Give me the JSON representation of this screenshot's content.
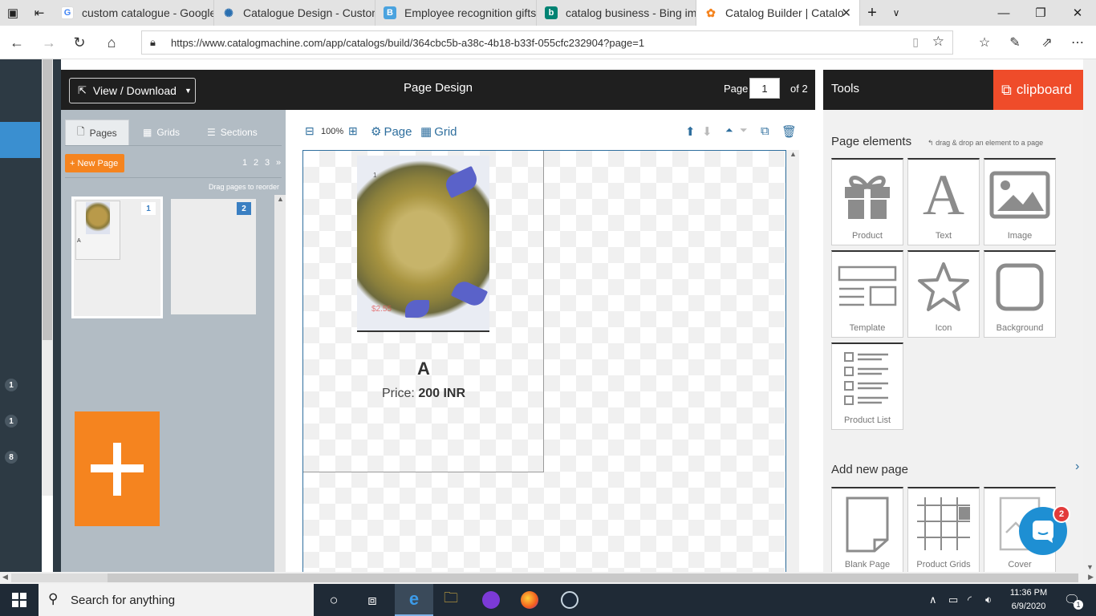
{
  "browser": {
    "tabs": [
      {
        "title": "custom catalogue - Google",
        "icon": "google-icon"
      },
      {
        "title": "Catalogue Design - Custom",
        "icon": "gear-icon"
      },
      {
        "title": "Employee recognition gifts",
        "icon": "b-icon"
      },
      {
        "title": "catalog business - Bing ima",
        "icon": "bing-icon"
      },
      {
        "title": "Catalog Builder | Catalo",
        "icon": "catalog-icon"
      }
    ],
    "url": "https://www.catalogmachine.com/app/catalogs/build/364cbc5b-a38c-4b18-b33f-055cfc232904?page=1"
  },
  "rail": {
    "badges": [
      "1",
      "1",
      "8"
    ]
  },
  "designer": {
    "view_download": "View / Download",
    "title": "Page Design",
    "page_label": "Page",
    "page_value": "1",
    "of_label": "of 2"
  },
  "pages_panel": {
    "tabs": [
      "Pages",
      "Grids",
      "Sections"
    ],
    "new_page": "+ New Page",
    "page_numbers": [
      "1",
      "2",
      "3",
      "»"
    ],
    "reorder_hint": "Drag pages to reorder",
    "thumbs": [
      {
        "num": "1",
        "caption": "A"
      },
      {
        "num": "2",
        "caption": ""
      }
    ]
  },
  "canvas_toolbar": {
    "zoom": "100%",
    "page_label": "Page",
    "grid_label": "Grid"
  },
  "product": {
    "title": "A",
    "price_label": "Price:",
    "price_value": "200 INR",
    "image_price_tag": "$2.55",
    "image_corner": "1"
  },
  "tools": {
    "title": "Tools",
    "clipboard": "clipboard",
    "elements_heading": "Page elements",
    "drag_hint": "drag & drop an element to a page",
    "elements": [
      "Product",
      "Text",
      "Image",
      "Template",
      "Icon",
      "Background",
      "Product List"
    ],
    "add_heading": "Add new page",
    "add_pages": [
      "Blank Page",
      "Product Grids",
      "Cover"
    ]
  },
  "chat": {
    "badge": "2"
  },
  "taskbar": {
    "search_placeholder": "Search for anything",
    "time": "11:36 PM",
    "date": "6/9/2020",
    "notifications": "1"
  },
  "colors": {
    "accent": "#f5841f",
    "clipboard": "#ef4c2a",
    "link": "#2f6f9e",
    "chat": "#1e8fd3"
  }
}
